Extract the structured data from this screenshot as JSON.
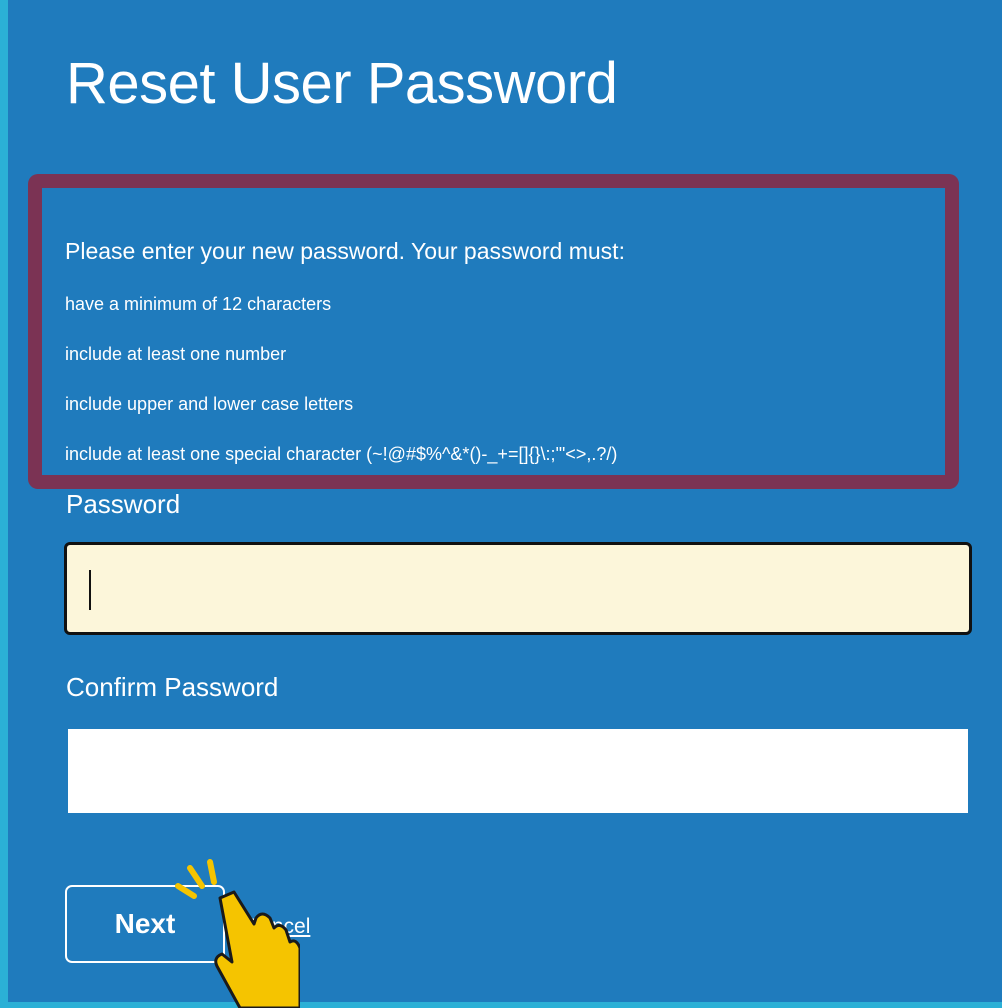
{
  "page": {
    "title": "Reset User Password"
  },
  "requirements": {
    "intro": "Please enter your new password. Your password must:",
    "items": [
      "have a minimum of 12 characters",
      "include at least one number",
      "include upper and lower case letters",
      "include at least one special character (~!@#$%^&*()-_+=[]{}\\:;'\"<>,.?/)"
    ]
  },
  "form": {
    "password_label": "Password",
    "password_value": "",
    "confirm_label": "Confirm Password",
    "confirm_value": "",
    "next_label": "Next",
    "cancel_label": "Cancel"
  },
  "colors": {
    "background": "#1f7bbd",
    "frame_accent": "#2bb0d6",
    "requirements_border": "#7b3354",
    "password_field_bg": "#fcf6da",
    "cursor_hand": "#f5c400"
  },
  "icons": {
    "pointer": "hand-pointer-icon"
  }
}
